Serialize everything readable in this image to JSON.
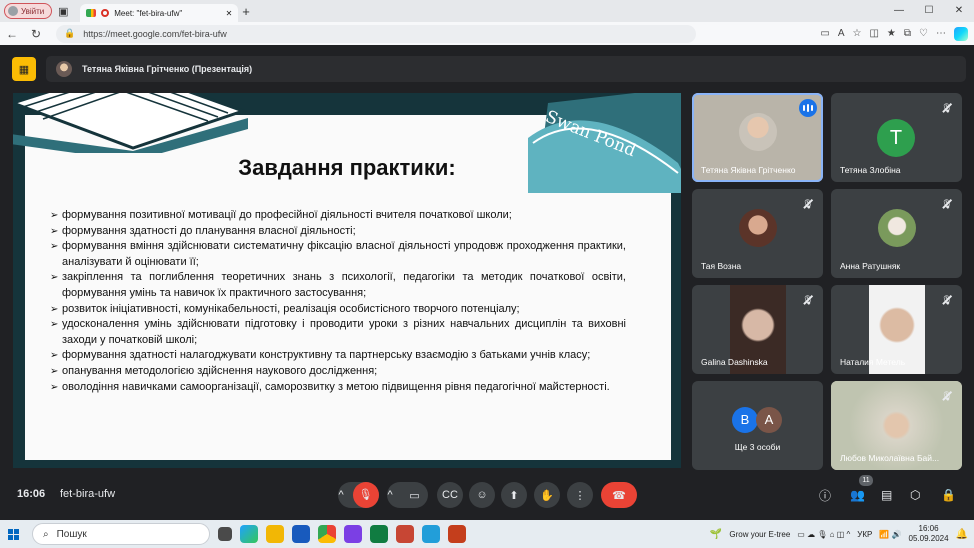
{
  "browser": {
    "profile_label": "Увійти",
    "tab_title": "Meet: \"fet-bira-ufw\"",
    "url": "https://meet.google.com/fet-bira-ufw",
    "win_minimize": "—",
    "win_maximize": "☐",
    "win_close": "✕"
  },
  "meet": {
    "presenter_banner": "Тетяна Яківна Грітченко (Презентація)",
    "time": "16:06",
    "meeting_code": "fet-bira-ufw",
    "participants_count": "11"
  },
  "slide": {
    "title": "Завдання практики:",
    "logo_text": "Swan Pond",
    "bullets": [
      "формування позитивної мотивації до професійної діяльності вчителя початкової школи;",
      "формування здатності до планування власної діяльності;",
      "формування вміння здійснювати систематичну фіксацію власної діяльності упродовж проходження практики, аналізувати й оцінювати її;",
      "закріплення та поглиблення теоретичних знань з психології, педагогіки та методик початкової освіти, формування умінь та навичок їх практичного застосування;",
      "розвиток ініціативності, комунікабельності, реалізація особистісного творчого потенціалу;",
      "удосконалення умінь здійснювати підготовку і проводити уроки з різних навчальних дисциплін та виховні заходи у початковій школі;",
      "формування здатності налагоджувати конструктивну та партнерську взаємодію з батьками учнів класу;",
      "опанування методологією здійснення наукового дослідження;",
      "оволодіння навичками самоорганізації, саморозвитку з метою підвищення рівня педагогічної майстерності."
    ]
  },
  "participants": [
    {
      "name": "Тетяна Яківна Грітченко"
    },
    {
      "name": "Тетяна Злобіна",
      "initial": "T"
    },
    {
      "name": "Тая Возна"
    },
    {
      "name": "Анна Ратушняк"
    },
    {
      "name": "Galina Dashinska"
    },
    {
      "name": "Наталия Метель"
    },
    {
      "name": "Ще 3 особи",
      "initials": [
        "B",
        "A"
      ]
    },
    {
      "name": "Любов Миколаївна Бaй..."
    }
  ],
  "taskbar": {
    "search_placeholder": "Пошук",
    "weather": "Grow your E-tree",
    "language": "УКР",
    "clock_time": "16:06",
    "clock_date": "05.09.2024"
  },
  "colors": {
    "meet_bg": "#202124",
    "tile_bg": "#3c4043",
    "end_call": "#ea4335",
    "present_icon": "#fbbc04",
    "slide_bg": "#15343b",
    "speaking": "#1a73e8",
    "avatar_green": "#2e9f4e"
  }
}
